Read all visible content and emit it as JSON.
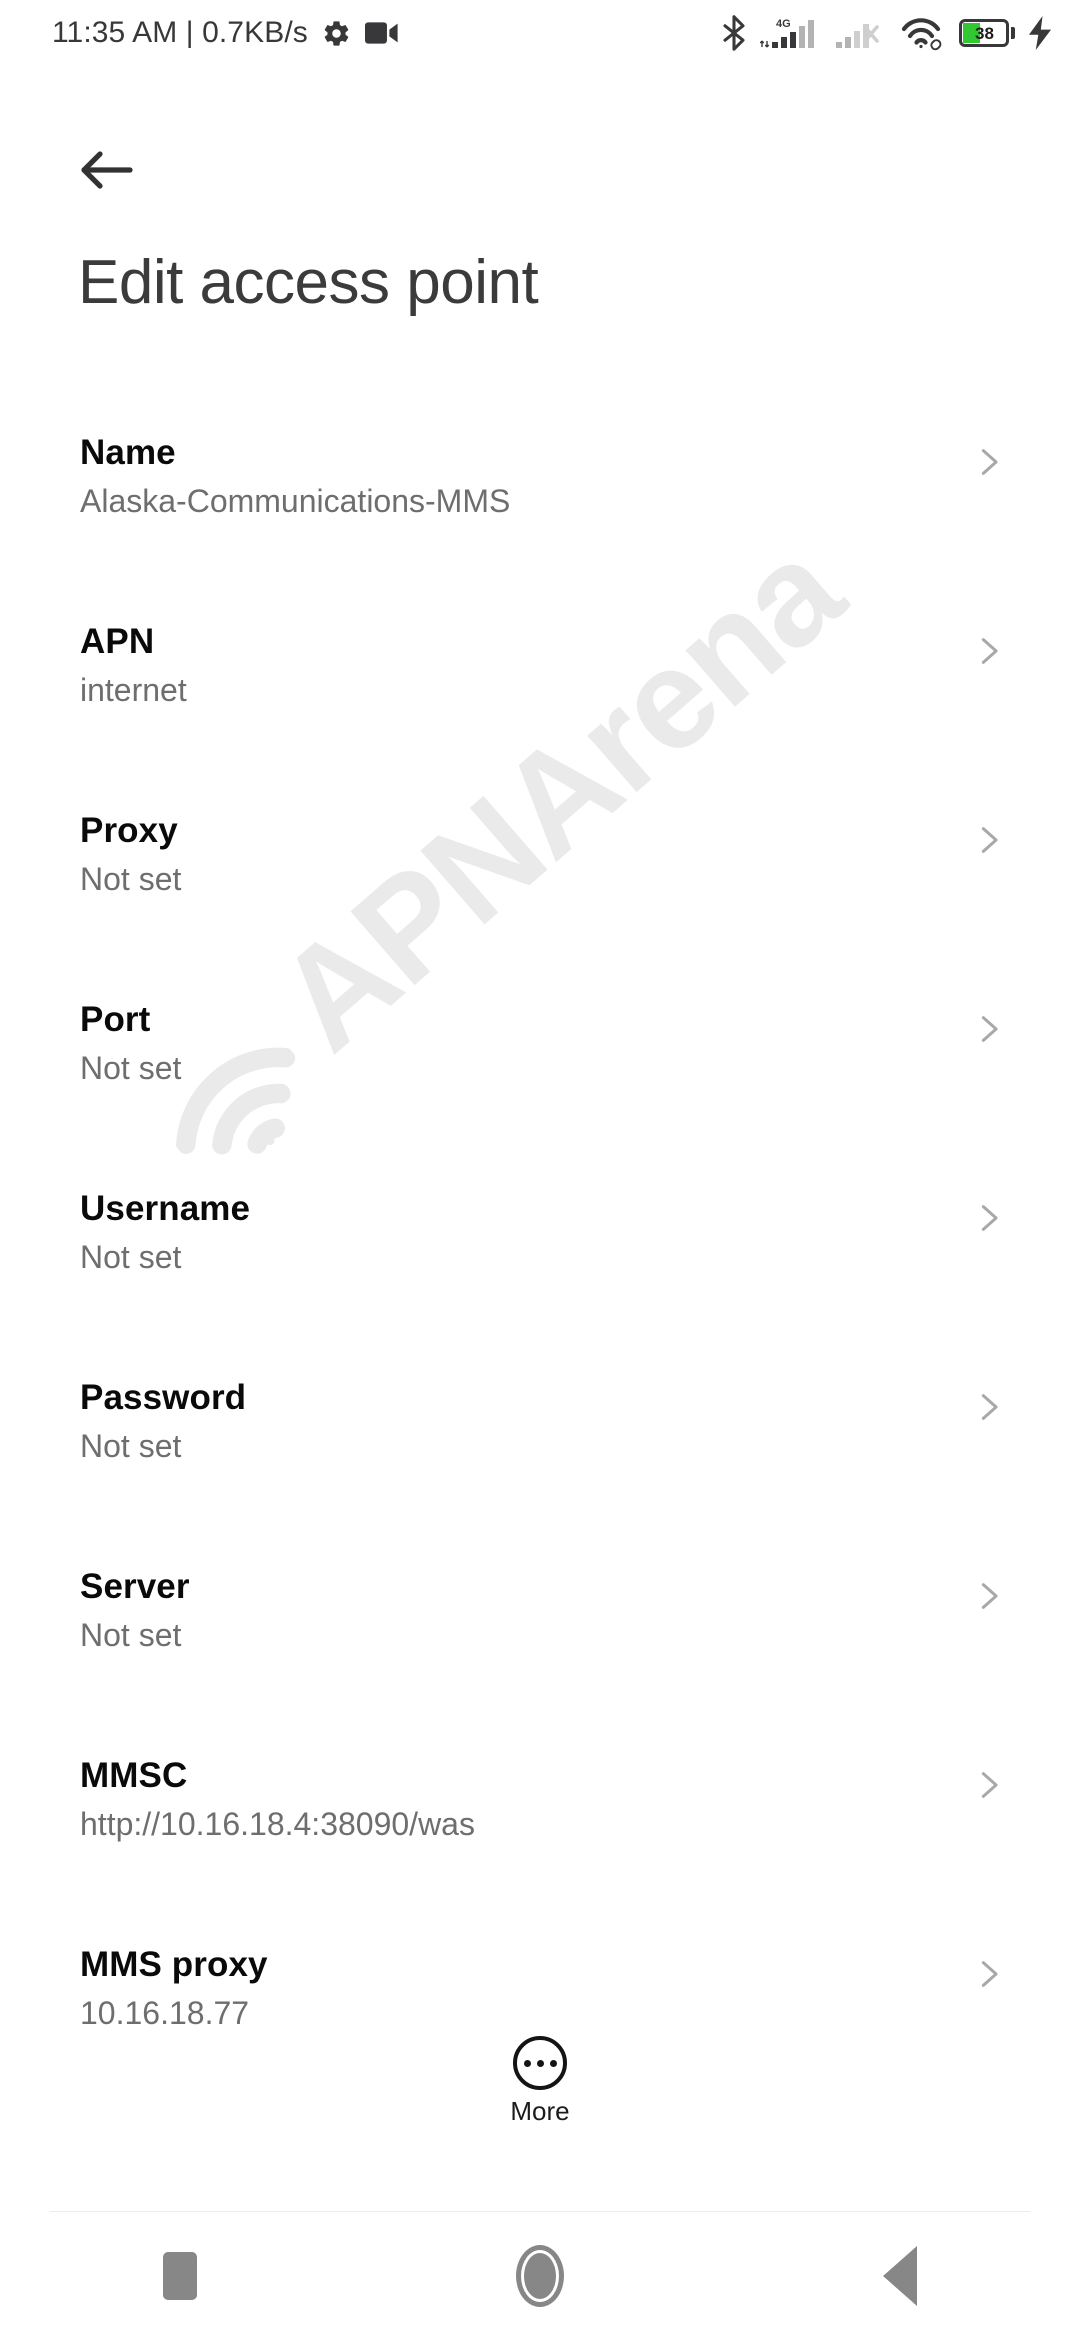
{
  "status_bar": {
    "clock_text": "11:35 AM | 0.7KB/s",
    "icons_left": [
      "gear-icon",
      "video-camera-icon"
    ],
    "icons_right": [
      "bluetooth-icon",
      "sim1-4g-signal-icon",
      "sim2-signal-off-icon",
      "wifi-icon",
      "battery-icon",
      "charging-bolt-icon"
    ],
    "network_type": "4G",
    "battery_percent": "38",
    "battery_color": "#32c832"
  },
  "header": {
    "back_label": "back-arrow",
    "title": "Edit access point"
  },
  "watermark": {
    "text": "APNArena",
    "color": "#eaeaea"
  },
  "list": {
    "rows": [
      {
        "title": "Name",
        "value": "Alaska-Communications-MMS"
      },
      {
        "title": "APN",
        "value": "internet"
      },
      {
        "title": "Proxy",
        "value": "Not set"
      },
      {
        "title": "Port",
        "value": "Not set"
      },
      {
        "title": "Username",
        "value": "Not set"
      },
      {
        "title": "Password",
        "value": "Not set"
      },
      {
        "title": "Server",
        "value": "Not set"
      },
      {
        "title": "MMSC",
        "value": "http://10.16.18.4:38090/was"
      },
      {
        "title": "MMS proxy",
        "value": "10.16.18.77"
      }
    ]
  },
  "more_button": {
    "label": "More",
    "icon": "overflow-dots-circle-icon"
  },
  "nav_bar": {
    "recents_label": "recents-button",
    "home_label": "home-button",
    "back_label": "back-button"
  }
}
